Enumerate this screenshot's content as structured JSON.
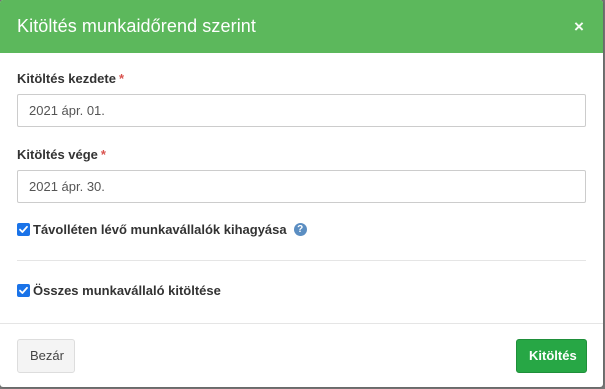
{
  "dialog": {
    "title": "Kitöltés munkaidőrend szerint",
    "close_symbol": "×"
  },
  "form": {
    "start": {
      "label": "Kitöltés kezdete",
      "required_mark": "*",
      "value": "2021 ápr. 01."
    },
    "end": {
      "label": "Kitöltés vége",
      "required_mark": "*",
      "value": "2021 ápr. 30."
    },
    "skip_absent": {
      "label": "Távolléten lévő munkavállalók kihagyása",
      "checked": true,
      "help_icon": "?"
    },
    "fill_all": {
      "label": "Összes munkavállaló kitöltése",
      "checked": true
    }
  },
  "footer": {
    "close_label": "Bezár",
    "submit_label": "Kitöltés"
  },
  "colors": {
    "header": "#5cb85c",
    "submit": "#27a745",
    "checkbox": "#1a73e8",
    "required": "#d9534f"
  }
}
